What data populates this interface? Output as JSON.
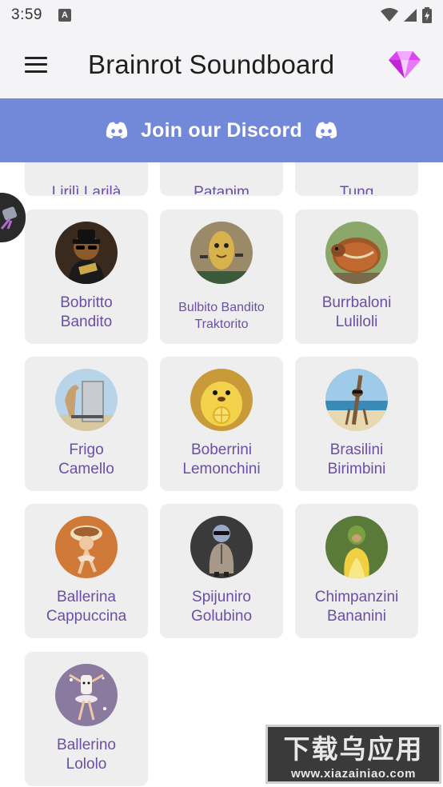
{
  "status_bar": {
    "time": "3:59",
    "notification_icon": "a-icon"
  },
  "app_bar": {
    "title": "Brainrot Soundboard",
    "menu_icon": "hamburger-menu-icon",
    "premium_icon": "diamond-icon"
  },
  "discord_banner": {
    "label": "Join our Discord",
    "icon": "discord-icon"
  },
  "colors": {
    "accent": "#7288d9",
    "card_bg": "#eeeeee",
    "card_text": "#6a4fa5",
    "premium": "#d946ef"
  },
  "sounds": [
    {
      "name": "Lirilì Larilà",
      "partial": true
    },
    {
      "name": "Patapim",
      "partial": true
    },
    {
      "name": "Tung",
      "partial": true
    },
    {
      "name": "Bobritto\nBandito"
    },
    {
      "name": "Bulbito Bandito\nTraktorito"
    },
    {
      "name": "Burrbaloni\nLuliloli"
    },
    {
      "name": "Frigo\nCamello"
    },
    {
      "name": "Boberrini\nLemonchini"
    },
    {
      "name": "Brasilini\nBirimbini"
    },
    {
      "name": "Ballerina\nCappuccina"
    },
    {
      "name": "Spijuniro\nGolubino"
    },
    {
      "name": "Chimpanzini\nBananini"
    },
    {
      "name": "Ballerino\nLololo"
    }
  ],
  "watermark": {
    "text_cn": "下载乌应用",
    "url": "www.xiazainiao.com"
  }
}
